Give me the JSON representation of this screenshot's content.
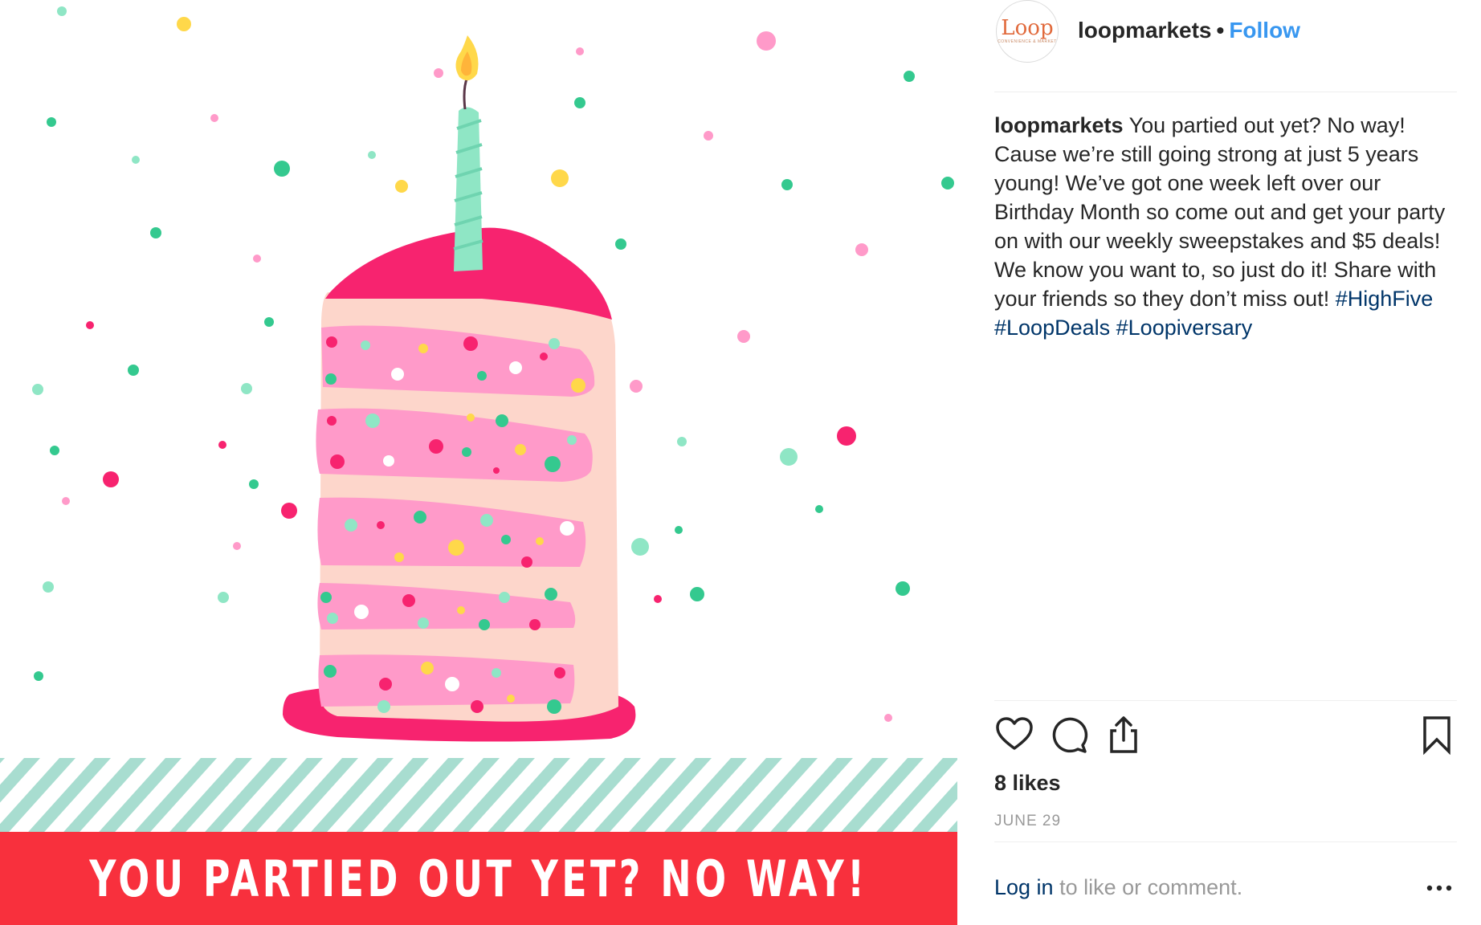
{
  "post": {
    "image": {
      "banner_text": "YOU PARTIED OUT YET? NO WAY!",
      "colors": {
        "banner": "#f8303d",
        "frosting": "#f7236f",
        "cake_layer": "#ff9ac9",
        "sponge": "#fdd6cb",
        "candle": "#8fe6c5",
        "stripes": "#a8ddd0"
      }
    },
    "header": {
      "avatar_logo": "Loop",
      "avatar_tagline": "CONVENIENCE & MARKET",
      "username": "loopmarkets",
      "separator": "•",
      "follow_label": "Follow"
    },
    "caption": {
      "username": "loopmarkets",
      "text": "You partied out yet? No way! Cause we’re still going strong at just 5 years young! We’ve got one week left over our Birthday Month so come out and get your party on with our weekly sweepstakes and $5 deals! We know you want to, so just do it! Share with your friends so they don’t miss out!",
      "hashtags": [
        "#HighFive",
        "#LoopDeals",
        "#Loopiversary"
      ]
    },
    "actions": {
      "icons": [
        "heart-icon",
        "comment-icon",
        "share-icon",
        "bookmark-icon"
      ]
    },
    "likes": "8 likes",
    "date": "JUNE 29",
    "login_prompt": {
      "link": "Log in",
      "rest": "to like or comment.",
      "more_icon": "more-options-icon"
    },
    "accent_colors": {
      "follow": "#3897f0",
      "hashtag": "#003569",
      "muted": "#999999"
    }
  }
}
